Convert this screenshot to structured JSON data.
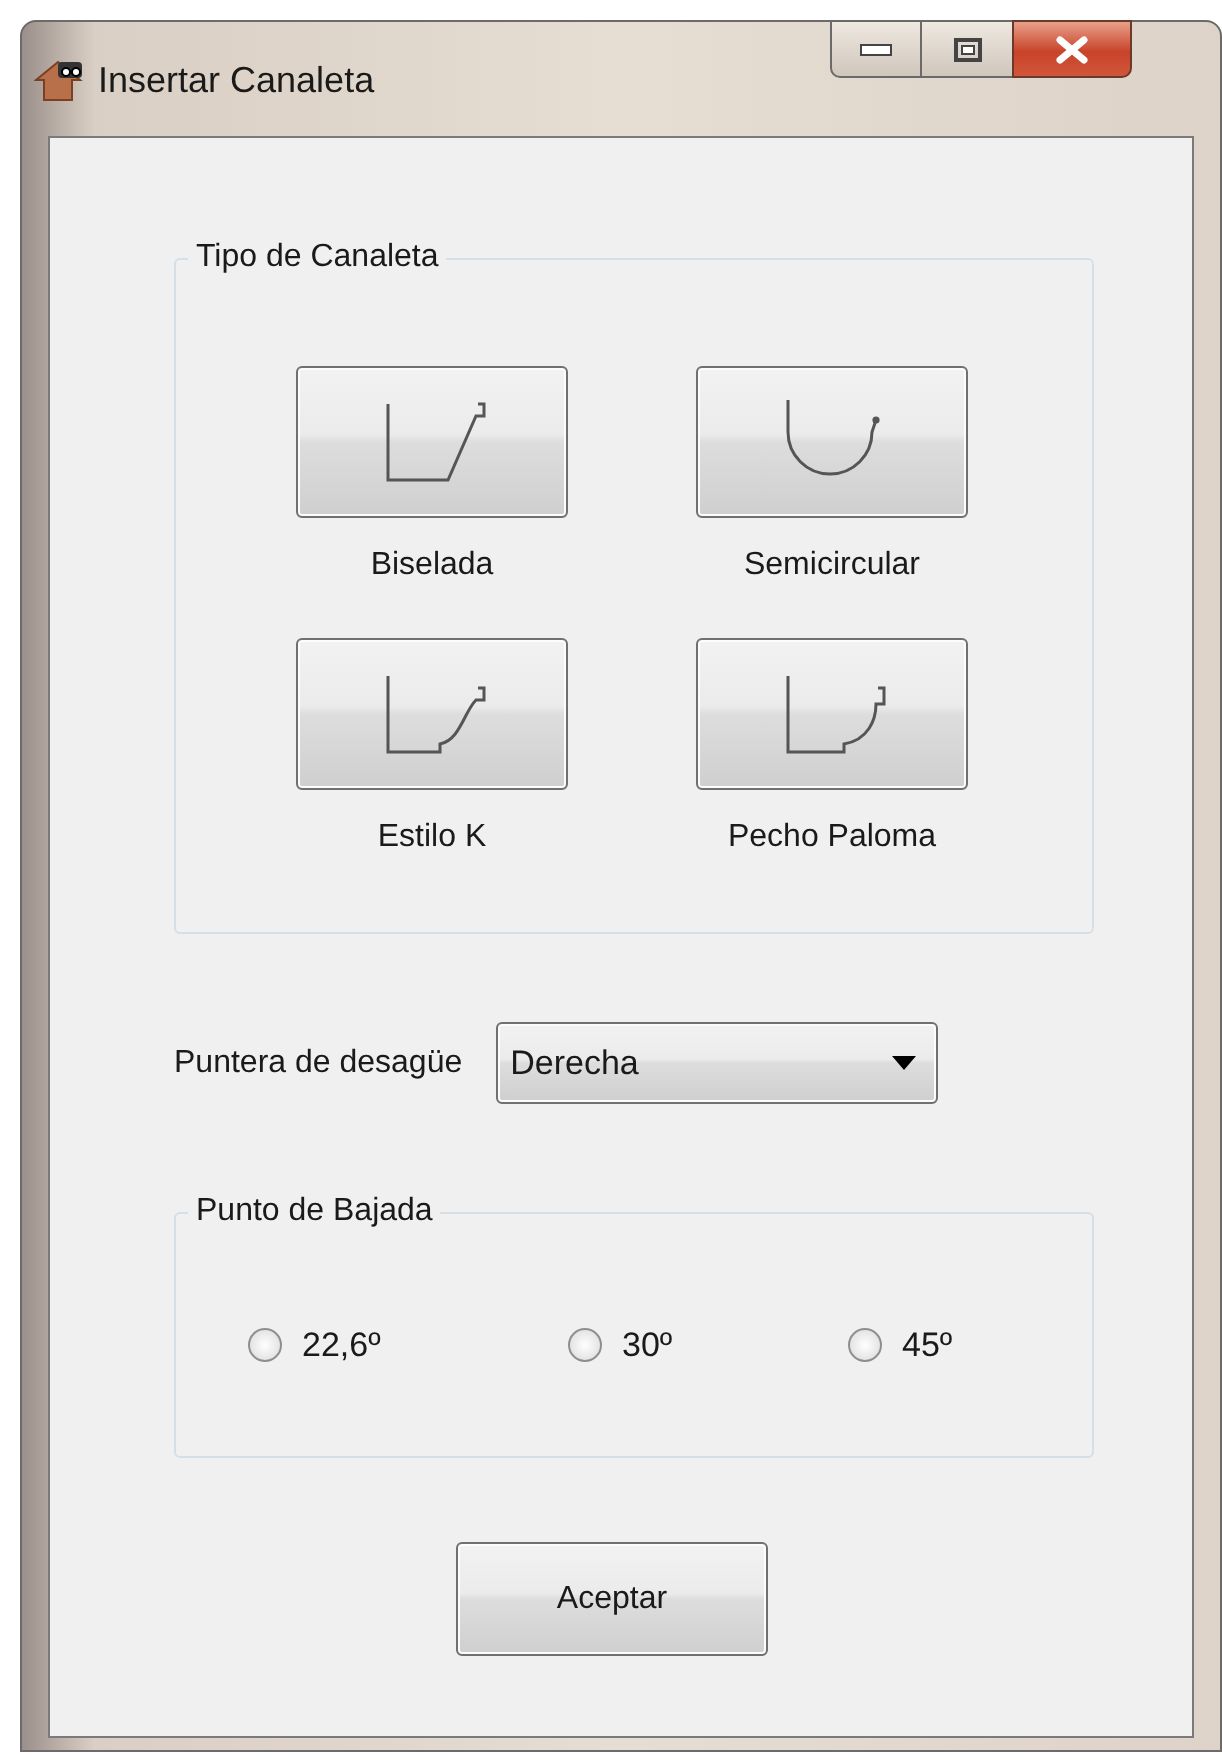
{
  "window": {
    "title": "Insertar Canaleta"
  },
  "gutter_type": {
    "title": "Tipo de Canaleta",
    "options": [
      {
        "label": "Biselada",
        "kind": "beveled"
      },
      {
        "label": "Semicircular",
        "kind": "half-round"
      },
      {
        "label": "Estilo K",
        "kind": "k-style"
      },
      {
        "label": "Pecho Paloma",
        "kind": "ogee"
      }
    ]
  },
  "drain_tip": {
    "label": "Puntera de desagüe",
    "value": "Derecha"
  },
  "drop_point": {
    "title": "Punto de Bajada",
    "options": [
      {
        "label": "22,6º",
        "selected": false
      },
      {
        "label": "30º",
        "selected": false
      },
      {
        "label": "45º",
        "selected": false
      }
    ]
  },
  "buttons": [
    {
      "label": "Aceptar"
    }
  ]
}
